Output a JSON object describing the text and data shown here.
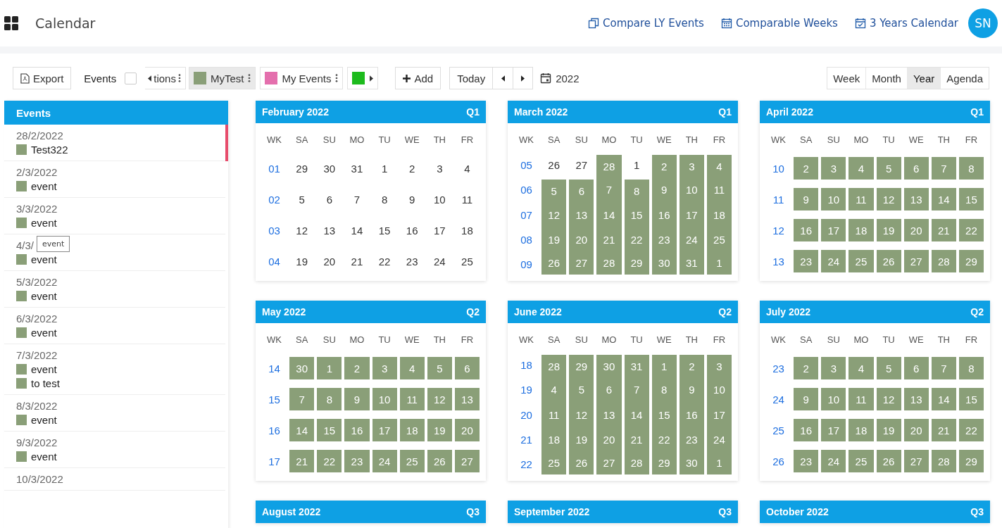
{
  "header": {
    "title": "Calendar",
    "links": [
      {
        "label": "Compare LY Events"
      },
      {
        "label": "Comparable Weeks"
      },
      {
        "label": "3 Years Calendar"
      }
    ],
    "avatar": "SN"
  },
  "toolbar": {
    "export": "Export",
    "events_label": "Events",
    "events_checked": false,
    "filters": [
      {
        "label": "tions",
        "kind": "cut",
        "selected": false
      },
      {
        "label": "MyTest",
        "kind": "chip",
        "color": "#8a9f78",
        "selected": true
      },
      {
        "label": "My Events",
        "kind": "chip",
        "color": "#e46fad",
        "selected": false
      },
      {
        "kind": "swatch",
        "color": "#1dbb1d",
        "selected": false
      }
    ],
    "add": "Add",
    "today": "Today",
    "year": "2022",
    "views": [
      {
        "label": "Week",
        "selected": false
      },
      {
        "label": "Month",
        "selected": false
      },
      {
        "label": "Year",
        "selected": true
      },
      {
        "label": "Agenda",
        "selected": false
      }
    ]
  },
  "sidebar": {
    "title": "Events",
    "items": [
      {
        "date": "28/2/2022",
        "selected": true,
        "events": [
          "Test322"
        ]
      },
      {
        "date": "2/3/2022",
        "selected": false,
        "events": [
          "event"
        ]
      },
      {
        "date": "3/3/2022",
        "selected": false,
        "events": [
          "event"
        ]
      },
      {
        "date": "4/3/",
        "selected": false,
        "tooltip": "event",
        "events": [
          "event"
        ]
      },
      {
        "date": "5/3/2022",
        "selected": false,
        "events": [
          "event"
        ]
      },
      {
        "date": "6/3/2022",
        "selected": false,
        "events": [
          "event"
        ]
      },
      {
        "date": "7/3/2022",
        "selected": false,
        "events": [
          "event",
          "to test"
        ]
      },
      {
        "date": "8/3/2022",
        "selected": false,
        "events": [
          "event"
        ]
      },
      {
        "date": "9/3/2022",
        "selected": false,
        "events": [
          "event"
        ]
      },
      {
        "date": "10/3/2022",
        "selected": false
      }
    ]
  },
  "months": [
    {
      "title": "February 2022",
      "quarter": "Q1",
      "kind": "span",
      "columns": [
        "WK",
        "SA",
        "SU",
        "MO",
        "TU",
        "WE",
        "TH",
        "FR"
      ],
      "weeks": [
        {
          "wk": "01",
          "days": [
            {
              "d": "29",
              "event": false
            },
            {
              "d": "30",
              "event": false
            },
            {
              "d": "31",
              "event": false
            },
            {
              "d": "1",
              "event": false
            },
            {
              "d": "2",
              "event": false
            },
            {
              "d": "3",
              "event": false
            },
            {
              "d": "4",
              "event": false
            }
          ]
        },
        {
          "wk": "02",
          "days": [
            {
              "d": "5",
              "event": false
            },
            {
              "d": "6",
              "event": false
            },
            {
              "d": "7",
              "event": false
            },
            {
              "d": "8",
              "event": false
            },
            {
              "d": "9",
              "event": false
            },
            {
              "d": "10",
              "event": false
            },
            {
              "d": "11",
              "event": false
            }
          ]
        },
        {
          "wk": "03",
          "days": [
            {
              "d": "12",
              "event": false
            },
            {
              "d": "13",
              "event": false
            },
            {
              "d": "14",
              "event": false
            },
            {
              "d": "15",
              "event": false
            },
            {
              "d": "16",
              "event": false
            },
            {
              "d": "17",
              "event": false
            },
            {
              "d": "18",
              "event": false
            }
          ]
        },
        {
          "wk": "04",
          "days": [
            {
              "d": "19",
              "event": false
            },
            {
              "d": "20",
              "event": false
            },
            {
              "d": "21",
              "event": false
            },
            {
              "d": "22",
              "event": false
            },
            {
              "d": "23",
              "event": false
            },
            {
              "d": "24",
              "event": false
            },
            {
              "d": "25",
              "event": false
            }
          ]
        }
      ]
    },
    {
      "title": "March 2022",
      "quarter": "Q1",
      "kind": "span",
      "columns": [
        "WK",
        "SA",
        "SU",
        "MO",
        "TU",
        "WE",
        "TH",
        "FR"
      ],
      "weeks": [
        {
          "wk": "05",
          "days": [
            {
              "d": "26",
              "event": false
            },
            {
              "d": "27",
              "event": false
            },
            {
              "d": "28",
              "event": true
            },
            {
              "d": "1",
              "event": false
            },
            {
              "d": "2",
              "event": true
            },
            {
              "d": "3",
              "event": true
            },
            {
              "d": "4",
              "event": true
            }
          ]
        },
        {
          "wk": "06",
          "days": [
            {
              "d": "5",
              "event": true
            },
            {
              "d": "6",
              "event": true
            },
            {
              "d": "7",
              "event": true
            },
            {
              "d": "8",
              "event": true
            },
            {
              "d": "9",
              "event": true
            },
            {
              "d": "10",
              "event": true
            },
            {
              "d": "11",
              "event": true
            }
          ]
        },
        {
          "wk": "07",
          "days": [
            {
              "d": "12",
              "event": true
            },
            {
              "d": "13",
              "event": true
            },
            {
              "d": "14",
              "event": true
            },
            {
              "d": "15",
              "event": true
            },
            {
              "d": "16",
              "event": true
            },
            {
              "d": "17",
              "event": true
            },
            {
              "d": "18",
              "event": true
            }
          ]
        },
        {
          "wk": "08",
          "days": [
            {
              "d": "19",
              "event": true
            },
            {
              "d": "20",
              "event": true
            },
            {
              "d": "21",
              "event": true
            },
            {
              "d": "22",
              "event": true
            },
            {
              "d": "23",
              "event": true
            },
            {
              "d": "24",
              "event": true
            },
            {
              "d": "25",
              "event": true
            }
          ]
        },
        {
          "wk": "09",
          "days": [
            {
              "d": "26",
              "event": true
            },
            {
              "d": "27",
              "event": true
            },
            {
              "d": "28",
              "event": true
            },
            {
              "d": "29",
              "event": true
            },
            {
              "d": "30",
              "event": true
            },
            {
              "d": "31",
              "event": true
            },
            {
              "d": "1",
              "event": true
            }
          ]
        }
      ]
    },
    {
      "title": "April 2022",
      "quarter": "Q1",
      "kind": "blocks",
      "columns": [
        "WK",
        "SA",
        "SU",
        "MO",
        "TU",
        "WE",
        "TH",
        "FR"
      ],
      "weeks": [
        {
          "wk": "10",
          "days": [
            {
              "d": "2",
              "event": true
            },
            {
              "d": "3",
              "event": true
            },
            {
              "d": "4",
              "event": true
            },
            {
              "d": "5",
              "event": true
            },
            {
              "d": "6",
              "event": true
            },
            {
              "d": "7",
              "event": true
            },
            {
              "d": "8",
              "event": true
            }
          ]
        },
        {
          "wk": "11",
          "days": [
            {
              "d": "9",
              "event": true
            },
            {
              "d": "10",
              "event": true
            },
            {
              "d": "11",
              "event": true
            },
            {
              "d": "12",
              "event": true
            },
            {
              "d": "13",
              "event": true
            },
            {
              "d": "14",
              "event": true
            },
            {
              "d": "15",
              "event": true
            }
          ]
        },
        {
          "wk": "12",
          "days": [
            {
              "d": "16",
              "event": true
            },
            {
              "d": "17",
              "event": true
            },
            {
              "d": "18",
              "event": true
            },
            {
              "d": "19",
              "event": true
            },
            {
              "d": "20",
              "event": true
            },
            {
              "d": "21",
              "event": true
            },
            {
              "d": "22",
              "event": true
            }
          ]
        },
        {
          "wk": "13",
          "days": [
            {
              "d": "23",
              "event": true
            },
            {
              "d": "24",
              "event": true
            },
            {
              "d": "25",
              "event": true
            },
            {
              "d": "26",
              "event": true
            },
            {
              "d": "27",
              "event": true
            },
            {
              "d": "28",
              "event": true
            },
            {
              "d": "29",
              "event": true
            }
          ]
        }
      ]
    },
    {
      "title": "May 2022",
      "quarter": "Q2",
      "kind": "blocks",
      "columns": [
        "WK",
        "SA",
        "SU",
        "MO",
        "TU",
        "WE",
        "TH",
        "FR"
      ],
      "weeks": [
        {
          "wk": "14",
          "days": [
            {
              "d": "30",
              "event": true
            },
            {
              "d": "1",
              "event": true
            },
            {
              "d": "2",
              "event": true
            },
            {
              "d": "3",
              "event": true
            },
            {
              "d": "4",
              "event": true
            },
            {
              "d": "5",
              "event": true
            },
            {
              "d": "6",
              "event": true
            }
          ]
        },
        {
          "wk": "15",
          "days": [
            {
              "d": "7",
              "event": true
            },
            {
              "d": "8",
              "event": true
            },
            {
              "d": "9",
              "event": true
            },
            {
              "d": "10",
              "event": true
            },
            {
              "d": "11",
              "event": true
            },
            {
              "d": "12",
              "event": true
            },
            {
              "d": "13",
              "event": true
            }
          ]
        },
        {
          "wk": "16",
          "days": [
            {
              "d": "14",
              "event": true
            },
            {
              "d": "15",
              "event": true
            },
            {
              "d": "16",
              "event": true
            },
            {
              "d": "17",
              "event": true
            },
            {
              "d": "18",
              "event": true
            },
            {
              "d": "19",
              "event": true
            },
            {
              "d": "20",
              "event": true
            }
          ]
        },
        {
          "wk": "17",
          "days": [
            {
              "d": "21",
              "event": true
            },
            {
              "d": "22",
              "event": true
            },
            {
              "d": "23",
              "event": true
            },
            {
              "d": "24",
              "event": true
            },
            {
              "d": "25",
              "event": true
            },
            {
              "d": "26",
              "event": true
            },
            {
              "d": "27",
              "event": true
            }
          ]
        }
      ]
    },
    {
      "title": "June 2022",
      "quarter": "Q2",
      "kind": "span",
      "columns": [
        "WK",
        "SA",
        "SU",
        "MO",
        "TU",
        "WE",
        "TH",
        "FR"
      ],
      "weeks": [
        {
          "wk": "18",
          "days": [
            {
              "d": "28",
              "event": true
            },
            {
              "d": "29",
              "event": true
            },
            {
              "d": "30",
              "event": true
            },
            {
              "d": "31",
              "event": true
            },
            {
              "d": "1",
              "event": true
            },
            {
              "d": "2",
              "event": true
            },
            {
              "d": "3",
              "event": true
            }
          ]
        },
        {
          "wk": "19",
          "days": [
            {
              "d": "4",
              "event": true
            },
            {
              "d": "5",
              "event": true
            },
            {
              "d": "6",
              "event": true
            },
            {
              "d": "7",
              "event": true
            },
            {
              "d": "8",
              "event": true
            },
            {
              "d": "9",
              "event": true
            },
            {
              "d": "10",
              "event": true
            }
          ]
        },
        {
          "wk": "20",
          "days": [
            {
              "d": "11",
              "event": true
            },
            {
              "d": "12",
              "event": true
            },
            {
              "d": "13",
              "event": true
            },
            {
              "d": "14",
              "event": true
            },
            {
              "d": "15",
              "event": true
            },
            {
              "d": "16",
              "event": true
            },
            {
              "d": "17",
              "event": true
            }
          ]
        },
        {
          "wk": "21",
          "days": [
            {
              "d": "18",
              "event": true
            },
            {
              "d": "19",
              "event": true
            },
            {
              "d": "20",
              "event": true
            },
            {
              "d": "21",
              "event": true
            },
            {
              "d": "22",
              "event": true
            },
            {
              "d": "23",
              "event": true
            },
            {
              "d": "24",
              "event": true
            }
          ]
        },
        {
          "wk": "22",
          "days": [
            {
              "d": "25",
              "event": true
            },
            {
              "d": "26",
              "event": true
            },
            {
              "d": "27",
              "event": true
            },
            {
              "d": "28",
              "event": true
            },
            {
              "d": "29",
              "event": true
            },
            {
              "d": "30",
              "event": true
            },
            {
              "d": "1",
              "event": true
            }
          ]
        }
      ]
    },
    {
      "title": "July 2022",
      "quarter": "Q2",
      "kind": "blocks",
      "columns": [
        "WK",
        "SA",
        "SU",
        "MO",
        "TU",
        "WE",
        "TH",
        "FR"
      ],
      "weeks": [
        {
          "wk": "23",
          "days": [
            {
              "d": "2",
              "event": true
            },
            {
              "d": "3",
              "event": true
            },
            {
              "d": "4",
              "event": true
            },
            {
              "d": "5",
              "event": true
            },
            {
              "d": "6",
              "event": true
            },
            {
              "d": "7",
              "event": true
            },
            {
              "d": "8",
              "event": true
            }
          ]
        },
        {
          "wk": "24",
          "days": [
            {
              "d": "9",
              "event": true
            },
            {
              "d": "10",
              "event": true
            },
            {
              "d": "11",
              "event": true
            },
            {
              "d": "12",
              "event": true
            },
            {
              "d": "13",
              "event": true
            },
            {
              "d": "14",
              "event": true
            },
            {
              "d": "15",
              "event": true
            }
          ]
        },
        {
          "wk": "25",
          "days": [
            {
              "d": "16",
              "event": true
            },
            {
              "d": "17",
              "event": true
            },
            {
              "d": "18",
              "event": true
            },
            {
              "d": "19",
              "event": true
            },
            {
              "d": "20",
              "event": true
            },
            {
              "d": "21",
              "event": true
            },
            {
              "d": "22",
              "event": true
            }
          ]
        },
        {
          "wk": "26",
          "days": [
            {
              "d": "23",
              "event": true
            },
            {
              "d": "24",
              "event": true
            },
            {
              "d": "25",
              "event": true
            },
            {
              "d": "26",
              "event": true
            },
            {
              "d": "27",
              "event": true
            },
            {
              "d": "28",
              "event": true
            },
            {
              "d": "29",
              "event": true
            }
          ]
        }
      ]
    },
    {
      "title": "August 2022",
      "quarter": "Q3"
    },
    {
      "title": "September 2022",
      "quarter": "Q3"
    },
    {
      "title": "October 2022",
      "quarter": "Q3"
    }
  ]
}
